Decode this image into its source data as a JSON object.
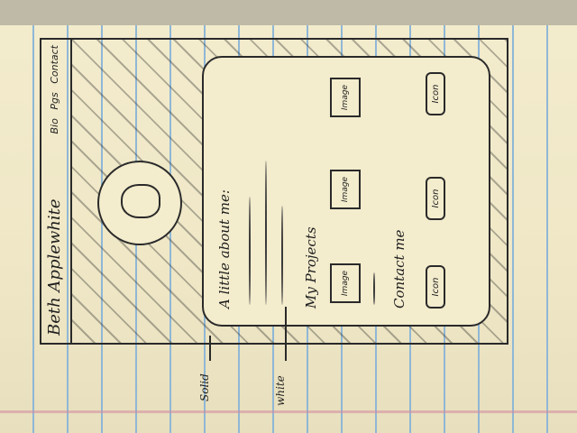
{
  "header": {
    "site_name": "Beth Applewhite",
    "nav": [
      "Bio",
      "Pgs",
      "Contact"
    ]
  },
  "about": {
    "title": "A little about me:"
  },
  "projects": {
    "title": "My Projects",
    "images": [
      "Image",
      "Image",
      "Image"
    ]
  },
  "contact": {
    "title": "Contact me",
    "icons": [
      "Icon",
      "Icon",
      "Icon"
    ]
  },
  "annotations": {
    "solid": "Solid",
    "white": "white"
  },
  "colors": {
    "paper": "#efe7c6",
    "ink": "#2a2a2a",
    "rule": "#8fb7d6"
  }
}
